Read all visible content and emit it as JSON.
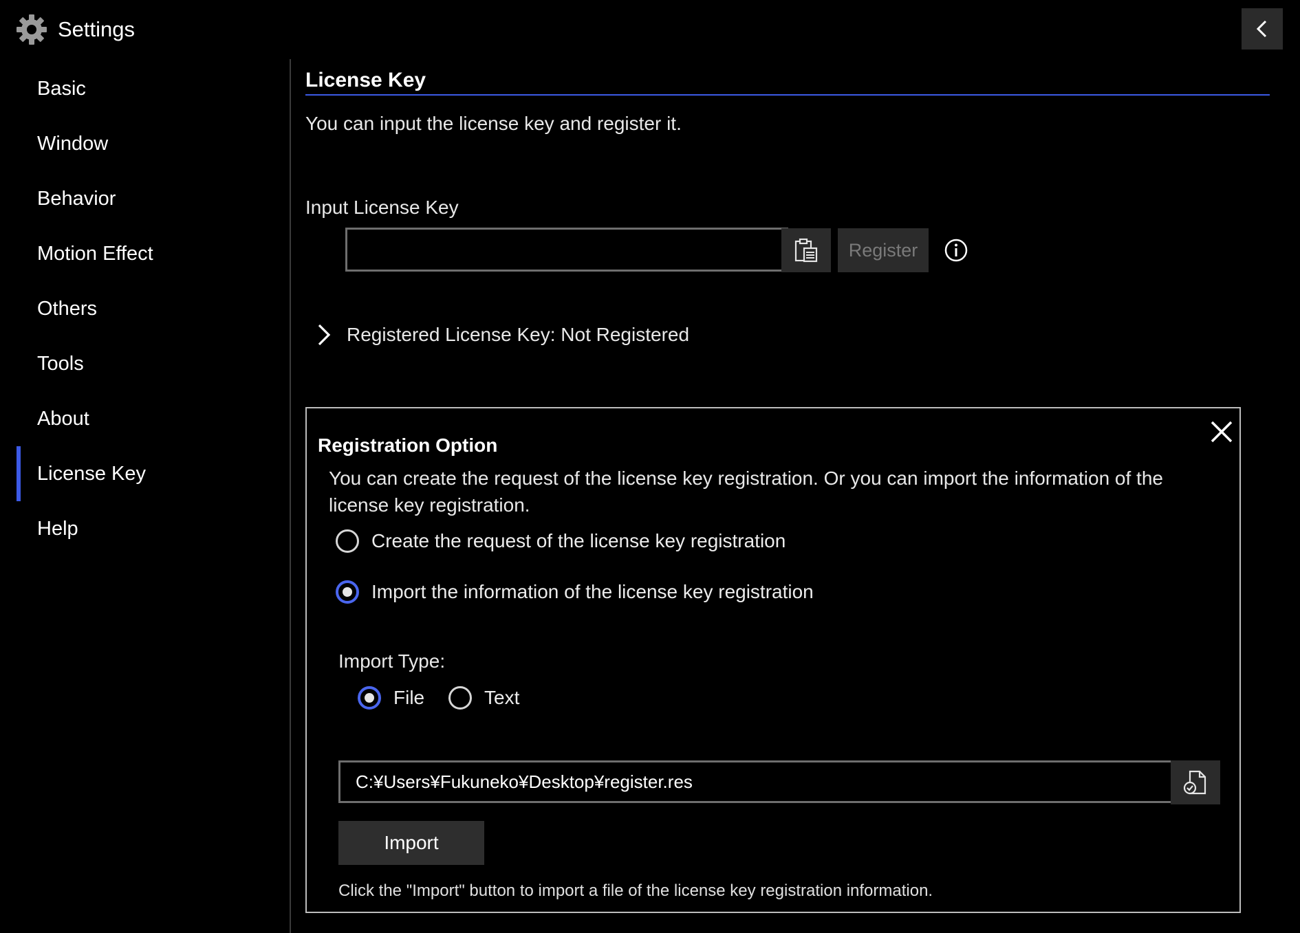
{
  "header": {
    "title": "Settings",
    "icon": "gear-icon",
    "back_icon": "chevron-left-icon"
  },
  "sidebar": {
    "items": [
      {
        "label": "Basic",
        "active": false
      },
      {
        "label": "Window",
        "active": false
      },
      {
        "label": "Behavior",
        "active": false
      },
      {
        "label": "Motion Effect",
        "active": false
      },
      {
        "label": "Others",
        "active": false
      },
      {
        "label": "Tools",
        "active": false
      },
      {
        "label": "About",
        "active": false
      },
      {
        "label": "License Key",
        "active": true
      },
      {
        "label": "Help",
        "active": false
      }
    ]
  },
  "main": {
    "title": "License Key",
    "description": "You can input the license key and register it.",
    "input_label": "Input License Key",
    "license_input_value": "",
    "paste_icon": "clipboard-paste-icon",
    "register_label": "Register",
    "info_icon": "info-icon",
    "registered_text": "Registered License Key: Not Registered"
  },
  "registration": {
    "title": "Registration Option",
    "description": "You can create the request of the license key registration. Or you can import the information of the license key registration.",
    "option_create": "Create the request of the license key registration",
    "option_import": "Import the information of the license key registration",
    "selected_option": "import",
    "import_type_label": "Import Type:",
    "type_file": "File",
    "type_text": "Text",
    "selected_type": "file",
    "path_value": "C:¥Users¥Fukuneko¥Desktop¥register.res",
    "browse_icon": "file-check-icon",
    "import_label": "Import",
    "hint": "Click the \"Import\" button to import a file of the license key registration information."
  },
  "colors": {
    "background": "#000000",
    "accent": "#3c5ae6",
    "button_bg": "#2b2b2b",
    "disabled_text": "#7a7a7a"
  }
}
